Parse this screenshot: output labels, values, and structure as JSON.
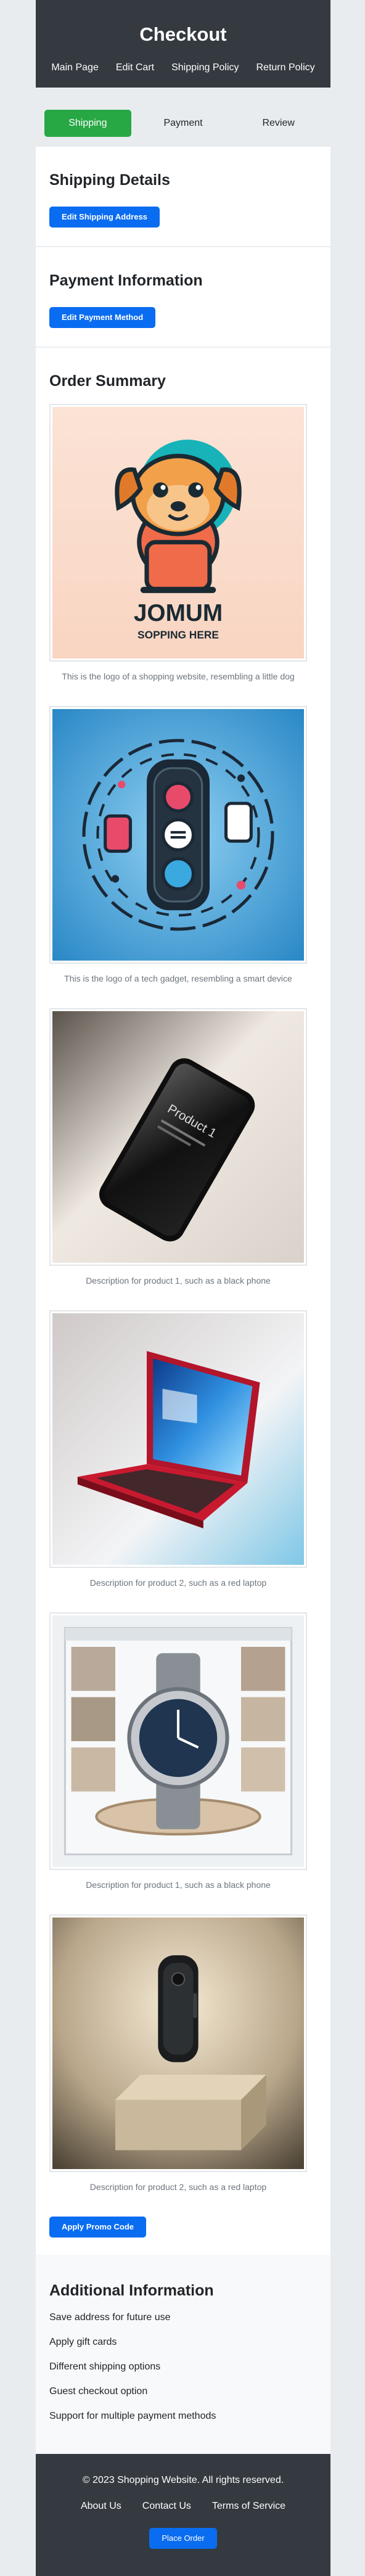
{
  "header": {
    "title": "Checkout",
    "nav": [
      "Main Page",
      "Edit Cart",
      "Shipping Policy",
      "Return Policy"
    ]
  },
  "steps": [
    "Shipping",
    "Payment",
    "Review"
  ],
  "shipping": {
    "title": "Shipping Details",
    "button": "Edit Shipping Address"
  },
  "payment": {
    "title": "Payment Information",
    "button": "Edit Payment Method"
  },
  "summary": {
    "title": "Order Summary",
    "logo_text_1": "JOMUM",
    "logo_text_2": "SOPPING HERE",
    "phone_text": "Product 1",
    "items": [
      "This is the logo of a shopping website, resembling a little dog",
      "This is the logo of a tech gadget, resembling a smart device",
      "Description for product 1, such as a black phone",
      "Description for product 2, such as a red laptop",
      "Description for product 1, such as a black phone",
      "Description for product 2, such as a red laptop"
    ],
    "promo_button": "Apply Promo Code"
  },
  "additional": {
    "title": "Additional Information",
    "items": [
      "Save address for future use",
      "Apply gift cards",
      "Different shipping options",
      "Guest checkout option",
      "Support for multiple payment methods"
    ]
  },
  "footer": {
    "copyright": "© 2023 Shopping Website. All rights reserved.",
    "links": [
      "About Us",
      "Contact Us",
      "Terms of Service"
    ],
    "button": "Place Order"
  },
  "colors": {
    "primary": "#0a6cf0",
    "success": "#28a745",
    "dark": "#343a40"
  }
}
